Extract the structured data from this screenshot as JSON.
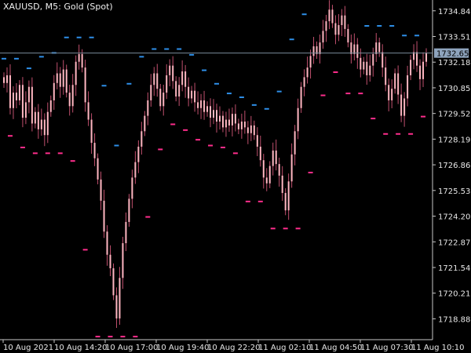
{
  "header": {
    "symbol": "XAUUSD, M5:",
    "description": "Gold (Spot)"
  },
  "colors": {
    "background": "#000000",
    "candle": "#ffb6c1",
    "wick": "#c0506e",
    "dot_blue": "#2e8fe8",
    "dot_pink": "#ff2d8c",
    "axis_text": "#e8e8e8",
    "axis_line": "#c8c8c8",
    "price_line": "#7a8a99",
    "price_tag_bg": "#8ea4bd"
  },
  "chart_data": {
    "type": "candlestick",
    "title": "",
    "ylim": [
      1717.8,
      1735.4
    ],
    "grid": false,
    "y_ticks": [
      "1734.84",
      "1733.51",
      "1732.18",
      "1730.85",
      "1729.52",
      "1728.19",
      "1726.86",
      "1725.53",
      "1724.20",
      "1722.87",
      "1721.54",
      "1720.21",
      "1718.88"
    ],
    "x_ticks": [
      "10 Aug 2021",
      "10 Aug 14:20",
      "10 Aug 17:00",
      "10 Aug 19:40",
      "10 Aug 22:20",
      "11 Aug 02:10",
      "11 Aug 04:50",
      "11 Aug 07:30",
      "11 Aug 10:10"
    ],
    "current_price": 1732.65,
    "current_price_label": "1732.65",
    "close": [
      1731.1,
      1731.5,
      1729.8,
      1730.6,
      1730.2,
      1731.0,
      1729.3,
      1730.1,
      1730.9,
      1729.0,
      1729.6,
      1728.7,
      1729.2,
      1728.4,
      1729.6,
      1730.2,
      1731.1,
      1731.6,
      1730.9,
      1731.8,
      1730.6,
      1729.9,
      1731.0,
      1732.2,
      1732.6,
      1731.9,
      1730.1,
      1729.2,
      1728.0,
      1727.2,
      1726.1,
      1725.0,
      1723.4,
      1722.2,
      1721.5,
      1720.1,
      1718.9,
      1721.0,
      1722.8,
      1723.9,
      1725.1,
      1726.2,
      1727.0,
      1727.8,
      1728.6,
      1729.4,
      1730.2,
      1731.0,
      1731.6,
      1730.8,
      1729.9,
      1730.6,
      1731.5,
      1732.0,
      1731.2,
      1730.4,
      1731.0,
      1731.7,
      1730.9,
      1730.3,
      1730.7,
      1730.1,
      1729.8,
      1730.2,
      1729.6,
      1729.9,
      1729.3,
      1729.7,
      1729.1,
      1729.4,
      1728.8,
      1729.2,
      1728.9,
      1729.5,
      1729.0,
      1728.7,
      1729.1,
      1728.8,
      1728.5,
      1728.9,
      1728.4,
      1727.8,
      1727.1,
      1726.2,
      1725.9,
      1726.8,
      1727.6,
      1726.9,
      1726.3,
      1725.4,
      1724.5,
      1726.0,
      1727.4,
      1728.6,
      1729.8,
      1730.9,
      1731.4,
      1731.9,
      1732.5,
      1733.0,
      1732.6,
      1733.2,
      1733.8,
      1734.3,
      1734.9,
      1734.2,
      1733.6,
      1734.1,
      1734.6,
      1733.9,
      1733.2,
      1732.6,
      1733.1,
      1732.4,
      1731.8,
      1732.2,
      1731.5,
      1732.0,
      1732.6,
      1733.2,
      1732.7,
      1731.9,
      1731.0,
      1730.2,
      1730.8,
      1731.6,
      1730.5,
      1729.4,
      1730.3,
      1731.5,
      1732.3,
      1732.7,
      1732.0,
      1731.3,
      1732.2,
      1732.65
    ]
  }
}
